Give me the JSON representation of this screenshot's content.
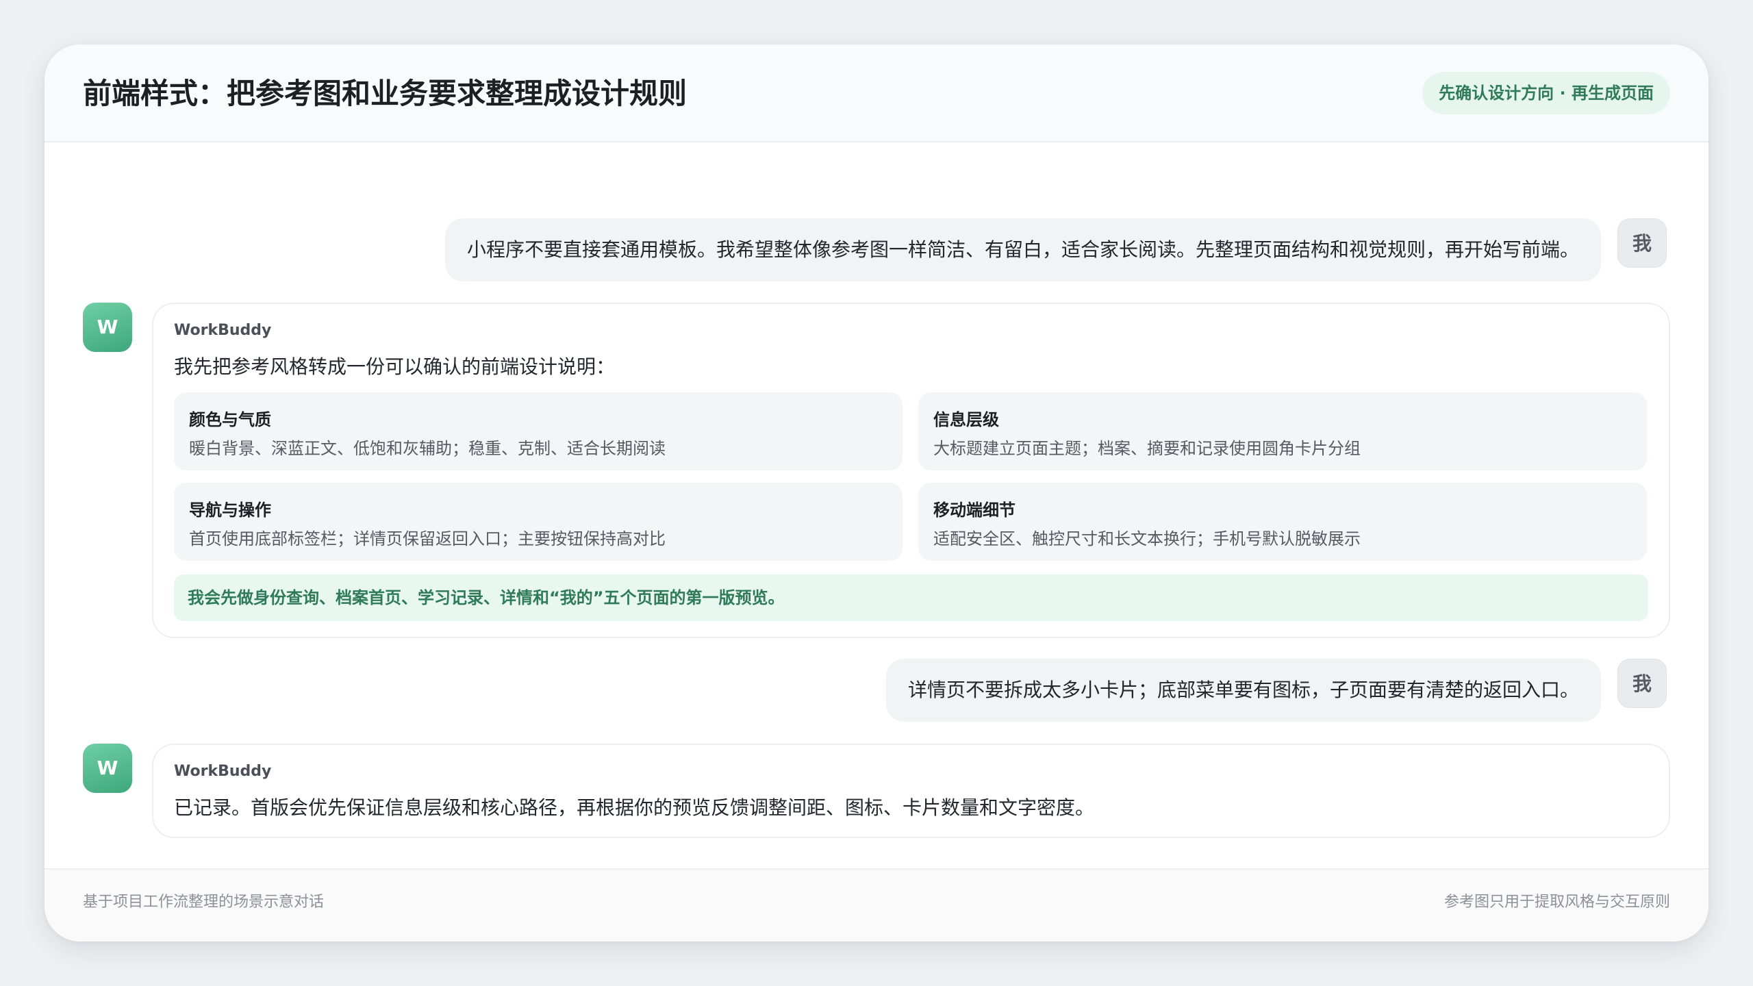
{
  "header": {
    "title": "前端样式：把参考图和业务要求整理成设计规则",
    "badge": "先确认设计方向 · 再生成页面"
  },
  "chat": {
    "user_avatar": "我",
    "bot_avatar": "W",
    "messages": [
      {
        "role": "user",
        "text": "小程序不要直接套通用模板。我希望整体像参考图一样简洁、有留白，适合家长阅读。先整理页面结构和视觉规则，再开始写前端。"
      },
      {
        "role": "assistant",
        "name": "WorkBuddy",
        "intro": "我先把参考风格转成一份可以确认的前端设计说明：",
        "items": [
          {
            "title": "颜色与气质",
            "desc": "暖白背景、深蓝正文、低饱和灰辅助；稳重、克制、适合长期阅读"
          },
          {
            "title": "信息层级",
            "desc": "大标题建立页面主题；档案、摘要和记录使用圆角卡片分组"
          },
          {
            "title": "导航与操作",
            "desc": "首页使用底部标签栏；详情页保留返回入口；主要按钮保持高对比"
          },
          {
            "title": "移动端细节",
            "desc": "适配安全区、触控尺寸和长文本换行；手机号默认脱敏展示"
          }
        ],
        "note": "我会先做身份查询、档案首页、学习记录、详情和“我的”五个页面的第一版预览。"
      },
      {
        "role": "user",
        "text": "详情页不要拆成太多小卡片；底部菜单要有图标，子页面要有清楚的返回入口。"
      },
      {
        "role": "assistant",
        "name": "WorkBuddy",
        "text": "已记录。首版会优先保证信息层级和核心路径，再根据你的预览反馈调整间距、图标、卡片数量和文字密度。"
      }
    ]
  },
  "footer": {
    "left": "基于项目工作流整理的场景示意对话",
    "right": "参考图只用于提取风格与交互原则"
  }
}
